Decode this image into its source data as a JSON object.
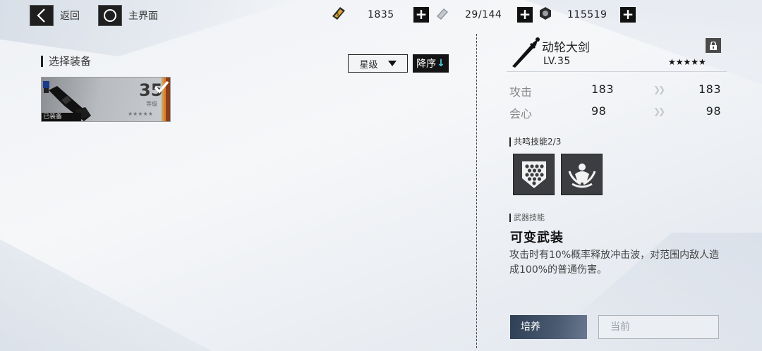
{
  "topbar": {
    "back_label": "返回",
    "home_label": "主界面",
    "resources": [
      {
        "icon": "gold-ticket-icon",
        "value": "1835"
      },
      {
        "icon": "battery-icon",
        "value": "29/144"
      },
      {
        "icon": "gear-nut-icon",
        "value": "115519"
      }
    ]
  },
  "left": {
    "section_title": "选择装备",
    "sort_select": "星级",
    "sort_order": "降序",
    "sort_order_icon": "↓",
    "card": {
      "level": "35",
      "level_label": "等级",
      "stars": "★★★★★",
      "equipped_label": "已装备"
    }
  },
  "right": {
    "weapon_name": "动轮大剑",
    "weapon_level": "LV.35",
    "weapon_stars": "★★★★★",
    "stats": [
      {
        "name": "攻击",
        "current": "183",
        "next": "183"
      },
      {
        "name": "会心",
        "current": "98",
        "next": "98"
      }
    ],
    "resonance_title": "共鸣技能",
    "resonance_count": "2/3",
    "resonance_skills": [
      "hex-shield-icon",
      "lotus-figure-icon"
    ],
    "weapon_skill_title": "武器技能",
    "weapon_skill_name": "可变武装",
    "weapon_skill_desc": "攻击时有10%概率释放冲击波，对范围内敌人造成100%的普通伤害。",
    "train_button": "培养",
    "current_button": "当前"
  },
  "colors": {
    "accent_cyan": "#4fd0e8",
    "dark": "#141414",
    "train_button": "#2f3f55"
  }
}
